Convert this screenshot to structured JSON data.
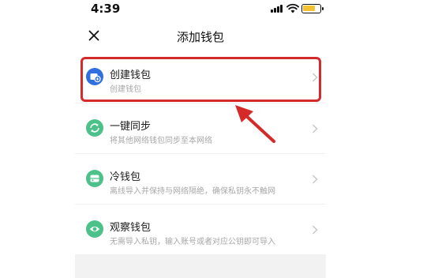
{
  "status_bar": {
    "time": "4:39"
  },
  "nav": {
    "title": "添加钱包",
    "close_icon": "close-icon"
  },
  "options": [
    {
      "title": "创建钱包",
      "description": "创建钱包",
      "icon": "create-wallet-icon",
      "color": "#2f6fe0"
    },
    {
      "title": "一键同步",
      "description": "将其他网络钱包同步至本网络",
      "icon": "sync-icon",
      "color": "#4cc28a"
    },
    {
      "title": "冷钱包",
      "description": "离线导入并保持与网络隔绝，确保私钥永不触网",
      "icon": "cold-wallet-icon",
      "color": "#4cc28a"
    },
    {
      "title": "观察钱包",
      "description": "无需导入私钥，输入账号或者对应公钥即可导入",
      "icon": "eye-icon",
      "color": "#4cc28a"
    }
  ],
  "colors": {
    "highlight": "#d42a2a",
    "accent_blue": "#2f6fe0",
    "accent_green": "#4cc28a"
  }
}
